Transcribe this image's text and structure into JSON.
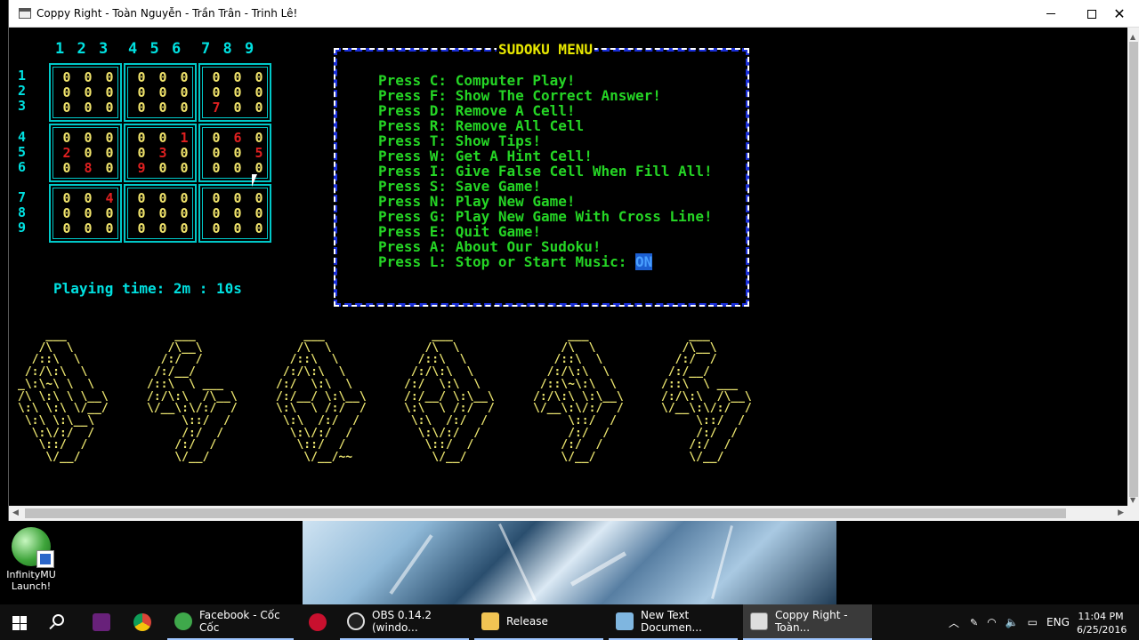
{
  "window": {
    "title": "Coppy Right - Toàn Nguyễn - Trần Trân - Trinh Lê!"
  },
  "grid": {
    "col_groups": [
      "1 2 3",
      "4 5 6",
      "7 8 9"
    ],
    "rows": [
      [
        "0",
        "0",
        "0",
        "0",
        "0",
        "0",
        "0",
        "0",
        "0"
      ],
      [
        "0",
        "0",
        "0",
        "0",
        "0",
        "0",
        "0",
        "0",
        "0"
      ],
      [
        "0",
        "0",
        "0",
        "0",
        "0",
        "0",
        "7",
        "0",
        "0"
      ],
      [
        "0",
        "0",
        "0",
        "0",
        "0",
        "1",
        "0",
        "6",
        "0"
      ],
      [
        "2",
        "0",
        "0",
        "0",
        "3",
        "0",
        "0",
        "0",
        "5"
      ],
      [
        "0",
        "8",
        "0",
        "9",
        "0",
        "0",
        "0",
        "0",
        "0"
      ],
      [
        "0",
        "0",
        "4",
        "0",
        "0",
        "0",
        "0",
        "0",
        "0"
      ],
      [
        "0",
        "0",
        "0",
        "0",
        "0",
        "0",
        "0",
        "0",
        "0"
      ],
      [
        "0",
        "0",
        "0",
        "0",
        "0",
        "0",
        "0",
        "0",
        "0"
      ]
    ],
    "row_labels": [
      "1",
      "2",
      "3",
      "4",
      "5",
      "6",
      "7",
      "8",
      "9"
    ],
    "colors": {
      "normal": "#f0e36b",
      "given": "#e02020",
      "border": "#00c8c8"
    }
  },
  "playtime": "Playing time: 2m : 10s",
  "menu": {
    "title": "SUDOKU MENU",
    "items": [
      "Press C: Computer Play!",
      "Press F: Show The Correct Answer!",
      "Press D: Remove A Cell!",
      "Press R: Remove All Cell",
      "Press T: Show Tips!",
      "Press W: Get A Hint Cell!",
      "Press I: Give False Cell When Fill All!",
      "Press S: Save Game!",
      "Press N: Play New Game!",
      "Press G: Play New Game With Cross Line!",
      "Press E: Quit Game!",
      "Press A: About Our Sudoku!"
    ],
    "music_label": "Press L: Stop or Start Music: ",
    "music_state": "ON"
  },
  "desktop": {
    "icon_label": "InfinityMU Launch!"
  },
  "taskbar": {
    "items": [
      {
        "label": "Facebook - Cốc Cốc",
        "icon": "coccoc-icon"
      },
      {
        "label": "OBS 0.14.2 (windo...",
        "icon": "obs-icon"
      },
      {
        "label": "Release",
        "icon": "folder-icon"
      },
      {
        "label": "New Text Documen...",
        "icon": "notepad-icon"
      },
      {
        "label": "Coppy Right - Toàn...",
        "icon": "console-icon"
      }
    ],
    "lang": "ENG",
    "time": "11:04 PM",
    "date": "6/25/2016"
  }
}
